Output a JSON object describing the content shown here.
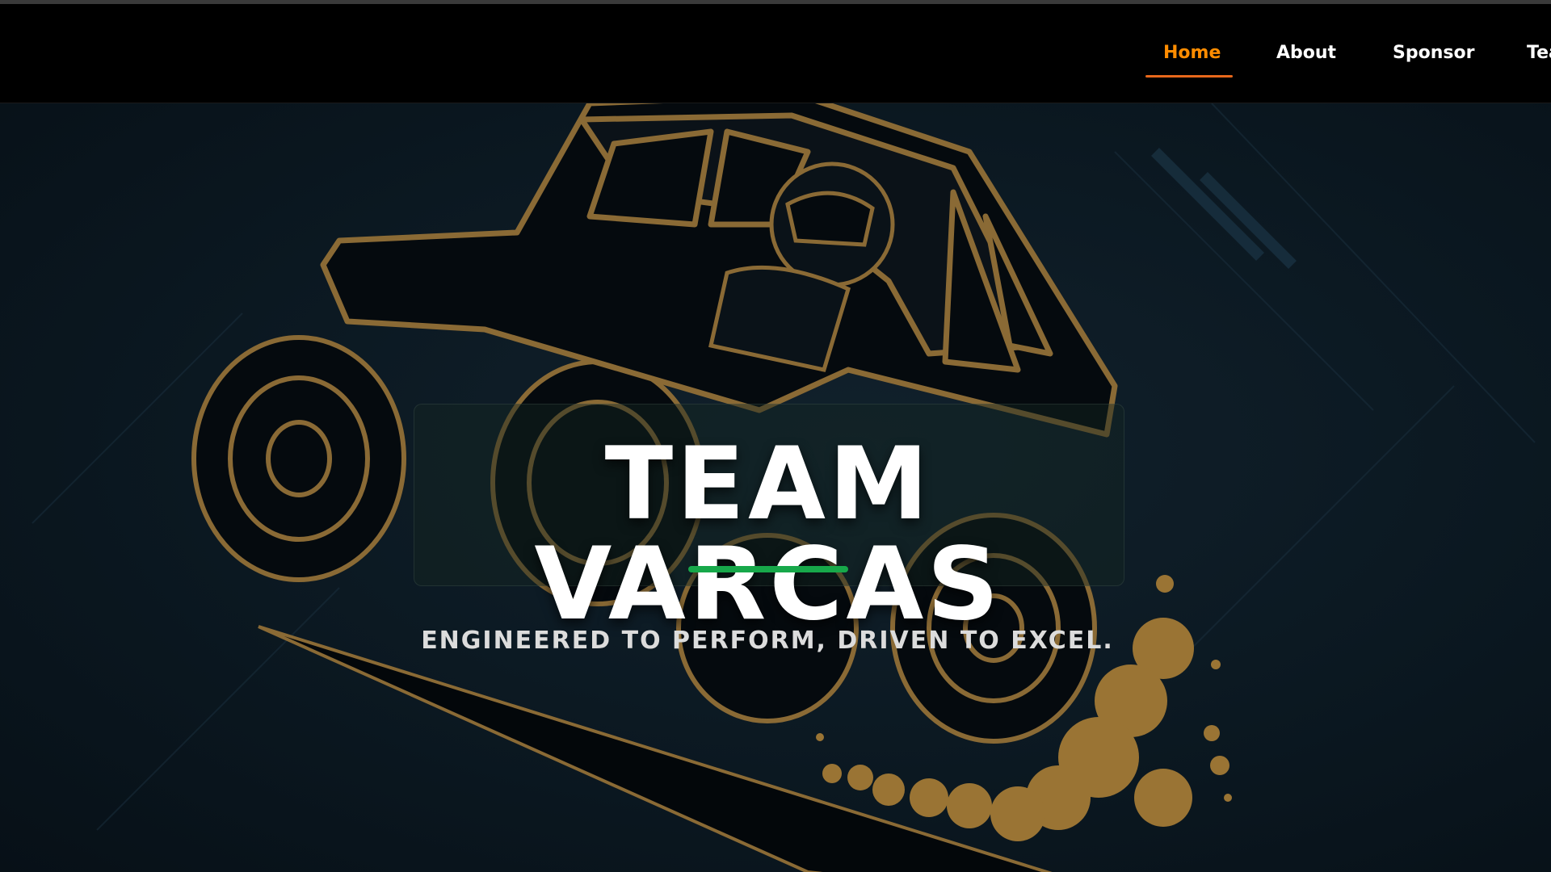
{
  "nav": {
    "items": [
      {
        "label": "Home",
        "active": true
      },
      {
        "label": "About",
        "active": false
      },
      {
        "label": "Sponsor",
        "active": false
      },
      {
        "label": "Tea",
        "active": false
      }
    ],
    "active_color": "#ff8c00",
    "underline_color": "#e8681b"
  },
  "hero": {
    "title": "TEAM VARCAS",
    "tagline": "ENGINEERED TO PERFORM, DRIVEN TO EXCEL.",
    "accent_color": "#17a84a",
    "art_icon": "off-road-buggy-icon",
    "art_colors": {
      "outline": "#8a6a35",
      "body": "#050a0e",
      "dust": "#9a7434"
    }
  }
}
